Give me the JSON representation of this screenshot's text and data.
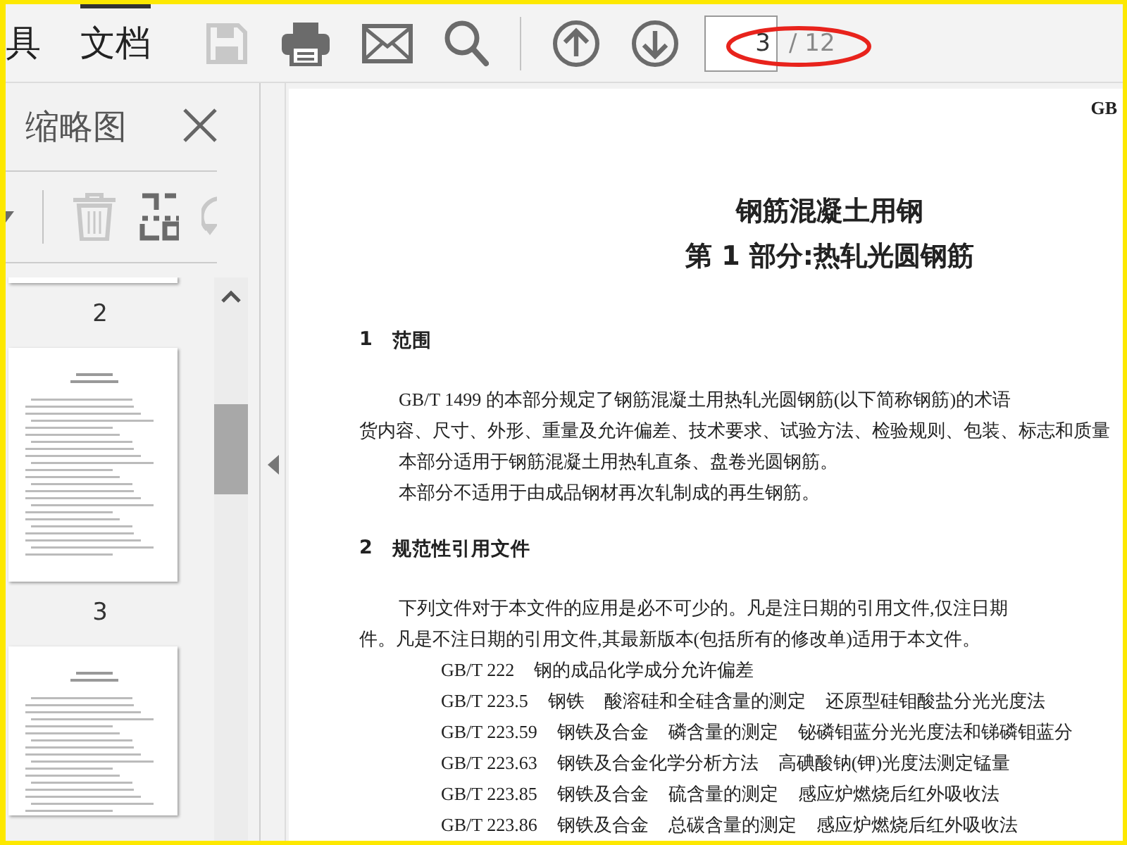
{
  "toolbar": {
    "tabs": [
      {
        "label": "具",
        "selected": false
      },
      {
        "label": "文档",
        "selected": true
      }
    ],
    "buttons": [
      {
        "kind": "save",
        "disabled": true
      },
      {
        "kind": "print",
        "disabled": false
      },
      {
        "kind": "mail",
        "disabled": false
      },
      {
        "kind": "search",
        "disabled": false
      },
      {
        "kind": "separator",
        "disabled": false
      },
      {
        "kind": "up",
        "disabled": false
      },
      {
        "kind": "down",
        "disabled": false
      }
    ],
    "page_field": {
      "value": "3"
    },
    "page_total": "/ 12"
  },
  "sidebar": {
    "title": "缩略图",
    "tools": [
      {
        "kind": "dropdown",
        "disabled": false
      },
      {
        "kind": "separator",
        "disabled": false
      },
      {
        "kind": "delete",
        "disabled": true
      },
      {
        "kind": "extract",
        "disabled": false
      },
      {
        "kind": "rotate",
        "disabled": true
      }
    ],
    "thumbnails": [
      {
        "label": "2"
      },
      {
        "label": "3"
      }
    ]
  },
  "document": {
    "running_head": "GB",
    "title_lines": [
      "钢筋混凝土用钢",
      "第 1 部分:热轧光圆钢筋"
    ],
    "blocks": [
      {
        "kind": "heading",
        "number": "1",
        "text": "范围"
      },
      {
        "kind": "indented",
        "text": "GB/T 1499 的本部分规定了钢筋混凝土用热轧光圆钢筋(以下简称钢筋)的术语"
      },
      {
        "kind": "continued",
        "text": "货内容、尺寸、外形、重量及允许偏差、技术要求、试验方法、检验规则、包装、标志和质量"
      },
      {
        "kind": "indented",
        "text": "本部分适用于钢筋混凝土用热轧直条、盘卷光圆钢筋。"
      },
      {
        "kind": "indented",
        "text": "本部分不适用于由成品钢材再次轧制成的再生钢筋。"
      },
      {
        "kind": "heading",
        "number": "2",
        "text": "规范性引用文件"
      },
      {
        "kind": "indented",
        "text": "下列文件对于本文件的应用是必不可少的。凡是注日期的引用文件,仅注日期"
      },
      {
        "kind": "continued",
        "text": "件。凡是不注日期的引用文件,其最新版本(包括所有的修改单)适用于本文件。"
      },
      {
        "kind": "ref",
        "code": "GB/T 222",
        "parts": [
          "钢的成品化学成分允许偏差"
        ]
      },
      {
        "kind": "ref",
        "code": "GB/T 223.5",
        "parts": [
          "钢铁",
          "酸溶硅和全硅含量的测定",
          "还原型硅钼酸盐分光光度法"
        ]
      },
      {
        "kind": "ref",
        "code": "GB/T 223.59",
        "parts": [
          "钢铁及合金",
          "磷含量的测定",
          "铋磷钼蓝分光光度法和锑磷钼蓝分"
        ]
      },
      {
        "kind": "ref",
        "code": "GB/T 223.63",
        "parts": [
          "钢铁及合金化学分析方法",
          "高碘酸钠(钾)光度法测定锰量"
        ]
      },
      {
        "kind": "ref",
        "code": "GB/T 223.85",
        "parts": [
          "钢铁及合金",
          "硫含量的测定",
          "感应炉燃烧后红外吸收法"
        ]
      },
      {
        "kind": "ref",
        "code": "GB/T 223.86",
        "parts": [
          "钢铁及合金",
          "总碳含量的测定",
          "感应炉燃烧后红外吸收法"
        ]
      }
    ]
  }
}
